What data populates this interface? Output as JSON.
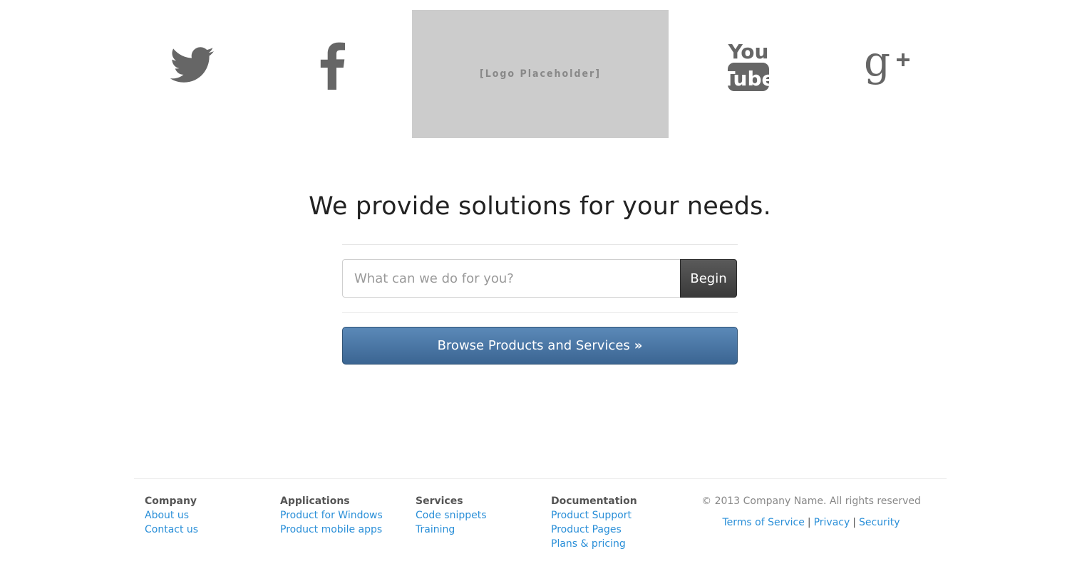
{
  "header": {
    "logo_text": "[Logo Placeholder]",
    "social": [
      {
        "name": "twitter-icon"
      },
      {
        "name": "facebook-icon"
      },
      {
        "name": "youtube-icon",
        "text_top": "You",
        "text_bottom": "Tube"
      },
      {
        "name": "google-plus-icon"
      }
    ],
    "icon_color": "#666666"
  },
  "hero": {
    "headline": "We provide solutions for your needs.",
    "search_placeholder": "What can we do for you?",
    "search_value": "",
    "begin_label": "Begin",
    "browse_label": "Browse Products and Services",
    "browse_icon": "double-chevron-right-icon",
    "browse_color": "#4a77a6",
    "begin_color": "#454545"
  },
  "footer": {
    "columns": [
      {
        "title": "Company",
        "links": [
          "About us",
          "Contact us"
        ]
      },
      {
        "title": "Applications",
        "links": [
          "Product for Windows",
          "Product mobile apps"
        ]
      },
      {
        "title": "Services",
        "links": [
          "Code snippets",
          "Training"
        ]
      },
      {
        "title": "Documentation",
        "links": [
          "Product Support",
          "Product Pages",
          "Plans & pricing"
        ]
      }
    ],
    "copyright": "© 2013 Company Name. All rights reserved",
    "legal_links": [
      "Terms of Service",
      "Privacy",
      "Security"
    ],
    "link_color": "#2a8fd8"
  }
}
